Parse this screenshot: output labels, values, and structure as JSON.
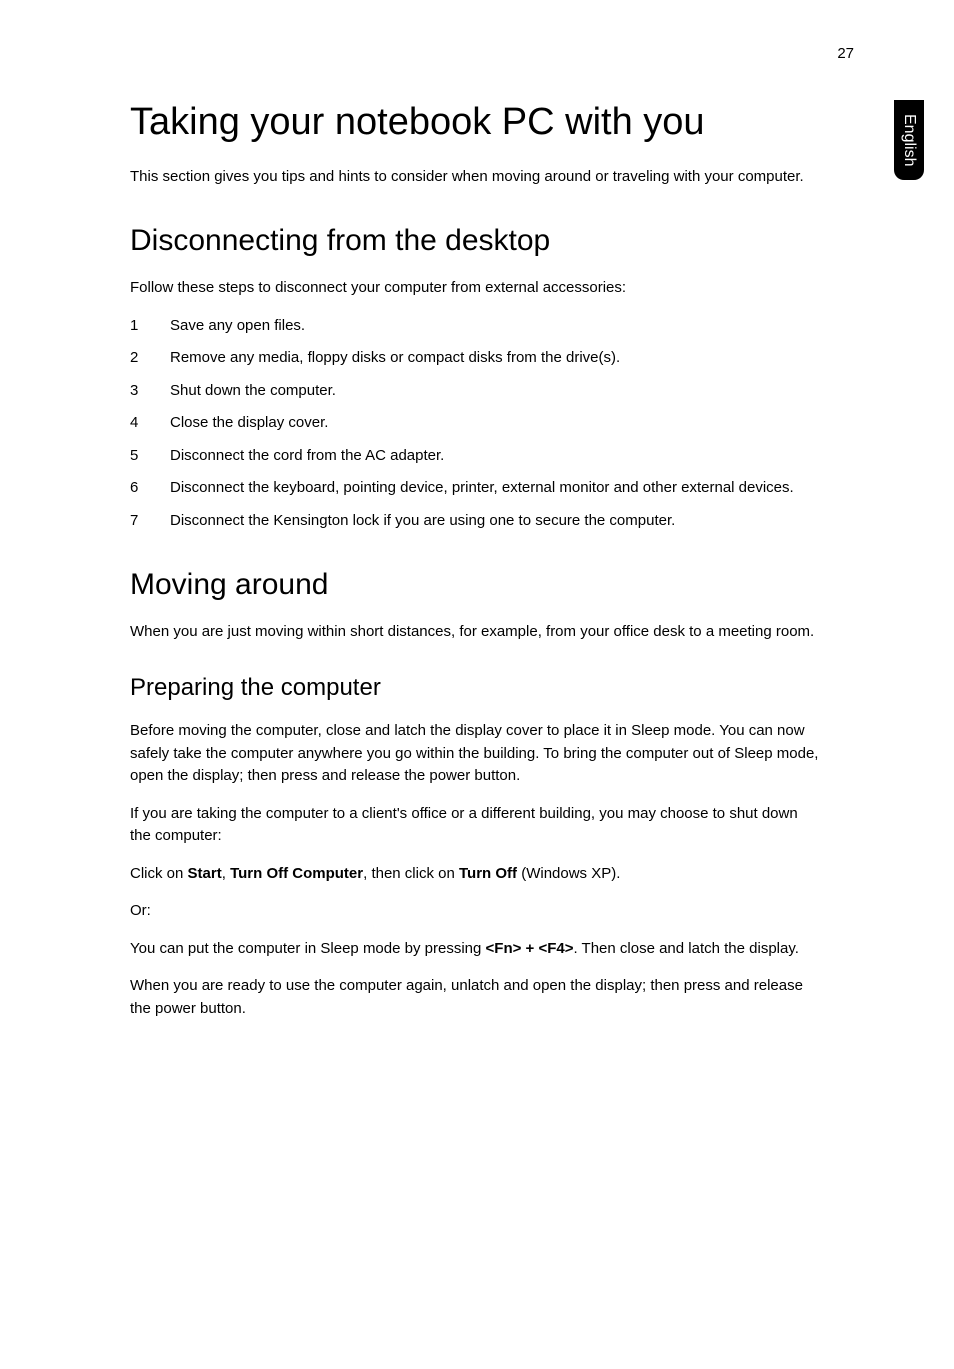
{
  "page_number": "27",
  "side_tab": "English",
  "h1": "Taking your notebook PC with you",
  "intro": "This section gives you tips and hints to consider when moving around or traveling with your computer.",
  "section1": {
    "heading": "Disconnecting from the desktop",
    "intro": "Follow these steps to disconnect your computer from external accessories:",
    "steps": [
      {
        "n": "1",
        "t": "Save any open files."
      },
      {
        "n": "2",
        "t": "Remove any media, floppy disks or compact disks from the drive(s)."
      },
      {
        "n": "3",
        "t": "Shut down the computer."
      },
      {
        "n": "4",
        "t": "Close the display cover."
      },
      {
        "n": "5",
        "t": "Disconnect the cord from the AC adapter."
      },
      {
        "n": "6",
        "t": "Disconnect the keyboard, pointing device, printer, external monitor and other external devices."
      },
      {
        "n": "7",
        "t": "Disconnect the Kensington lock if you are using one to secure the computer."
      }
    ]
  },
  "section2": {
    "heading": "Moving around",
    "intro": "When you are just moving within short distances, for example, from your office desk to a meeting room.",
    "sub": {
      "heading": "Preparing the computer",
      "p1": "Before moving the computer, close and latch the display cover to place it in Sleep mode. You can now safely take the computer anywhere you go within the building. To bring the computer out of Sleep mode, open the display; then press and release the power button.",
      "p2": "If you are taking the computer to a client's office or a different building, you may choose to shut down the computer:",
      "p3_pre": "Click on ",
      "p3_b1": "Start",
      "p3_mid1": ", ",
      "p3_b2": "Turn Off Computer",
      "p3_mid2": ", then click on ",
      "p3_b3": "Turn Off",
      "p3_post": " (Windows XP).",
      "p4": "Or:",
      "p5_pre": "You can put the computer in Sleep mode by pressing ",
      "p5_b1": "<Fn> + <F4>",
      "p5_post": ". Then close and latch the display.",
      "p6": "When you are ready to use the computer again, unlatch and open the display; then press and release the power button."
    }
  }
}
